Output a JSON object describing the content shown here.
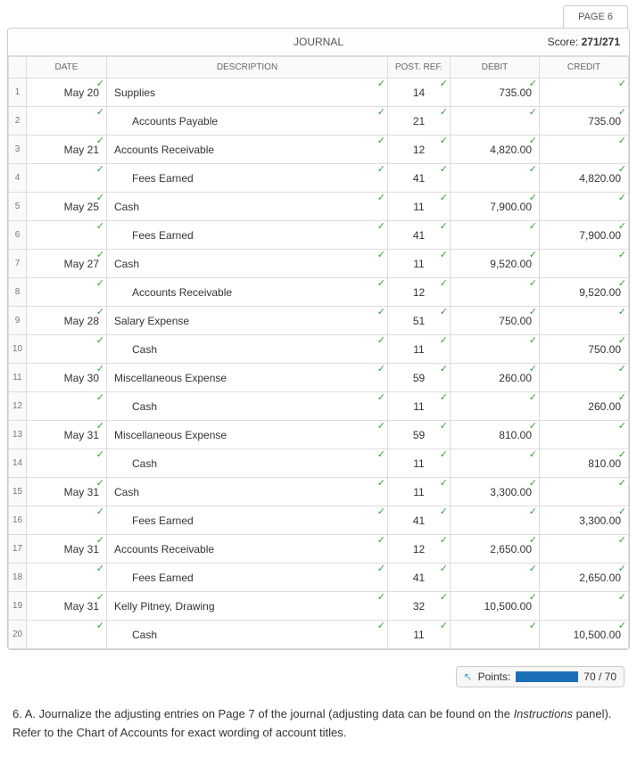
{
  "page_tab": "PAGE 6",
  "header": {
    "title": "JOURNAL",
    "score_label": "Score:",
    "score_value": "271/271"
  },
  "columns": {
    "rownum": "",
    "date": "DATE",
    "description": "DESCRIPTION",
    "postref": "POST. REF.",
    "debit": "DEBIT",
    "credit": "CREDIT"
  },
  "rows": [
    {
      "n": "1",
      "date": "May 20",
      "desc": "Supplies",
      "indent": false,
      "post": "14",
      "debit": "735.00",
      "credit": ""
    },
    {
      "n": "2",
      "date": "",
      "desc": "Accounts Payable",
      "indent": true,
      "post": "21",
      "debit": "",
      "credit": "735.00"
    },
    {
      "n": "3",
      "date": "May 21",
      "desc": "Accounts Receivable",
      "indent": false,
      "post": "12",
      "debit": "4,820.00",
      "credit": ""
    },
    {
      "n": "4",
      "date": "",
      "desc": "Fees Earned",
      "indent": true,
      "post": "41",
      "debit": "",
      "credit": "4,820.00"
    },
    {
      "n": "5",
      "date": "May 25",
      "desc": "Cash",
      "indent": false,
      "post": "11",
      "debit": "7,900.00",
      "credit": ""
    },
    {
      "n": "6",
      "date": "",
      "desc": "Fees Earned",
      "indent": true,
      "post": "41",
      "debit": "",
      "credit": "7,900.00"
    },
    {
      "n": "7",
      "date": "May 27",
      "desc": "Cash",
      "indent": false,
      "post": "11",
      "debit": "9,520.00",
      "credit": ""
    },
    {
      "n": "8",
      "date": "",
      "desc": "Accounts Receivable",
      "indent": true,
      "post": "12",
      "debit": "",
      "credit": "9,520.00"
    },
    {
      "n": "9",
      "date": "May 28",
      "desc": "Salary Expense",
      "indent": false,
      "post": "51",
      "debit": "750.00",
      "credit": ""
    },
    {
      "n": "10",
      "date": "",
      "desc": "Cash",
      "indent": true,
      "post": "11",
      "debit": "",
      "credit": "750.00"
    },
    {
      "n": "11",
      "date": "May 30",
      "desc": "Miscellaneous Expense",
      "indent": false,
      "post": "59",
      "debit": "260.00",
      "credit": ""
    },
    {
      "n": "12",
      "date": "",
      "desc": "Cash",
      "indent": true,
      "post": "11",
      "debit": "",
      "credit": "260.00"
    },
    {
      "n": "13",
      "date": "May 31",
      "desc": "Miscellaneous Expense",
      "indent": false,
      "post": "59",
      "debit": "810.00",
      "credit": ""
    },
    {
      "n": "14",
      "date": "",
      "desc": "Cash",
      "indent": true,
      "post": "11",
      "debit": "",
      "credit": "810.00"
    },
    {
      "n": "15",
      "date": "May 31",
      "desc": "Cash",
      "indent": false,
      "post": "11",
      "debit": "3,300.00",
      "credit": ""
    },
    {
      "n": "16",
      "date": "",
      "desc": "Fees Earned",
      "indent": true,
      "post": "41",
      "debit": "",
      "credit": "3,300.00"
    },
    {
      "n": "17",
      "date": "May 31",
      "desc": "Accounts Receivable",
      "indent": false,
      "post": "12",
      "debit": "2,650.00",
      "credit": ""
    },
    {
      "n": "18",
      "date": "",
      "desc": "Fees Earned",
      "indent": true,
      "post": "41",
      "debit": "",
      "credit": "2,650.00"
    },
    {
      "n": "19",
      "date": "May 31",
      "desc": "Kelly Pitney, Drawing",
      "indent": false,
      "post": "32",
      "debit": "10,500.00",
      "credit": ""
    },
    {
      "n": "20",
      "date": "",
      "desc": "Cash",
      "indent": true,
      "post": "11",
      "debit": "",
      "credit": "10,500.00"
    }
  ],
  "points": {
    "label": "Points:",
    "value": "70 / 70"
  },
  "instruction": {
    "prefix": "6. A. Journalize the adjusting entries on Page 7 of the journal (adjusting data can be found on the ",
    "ital": "Instructions",
    "suffix": " panel). Refer to the Chart of Accounts for exact wording of account titles."
  }
}
